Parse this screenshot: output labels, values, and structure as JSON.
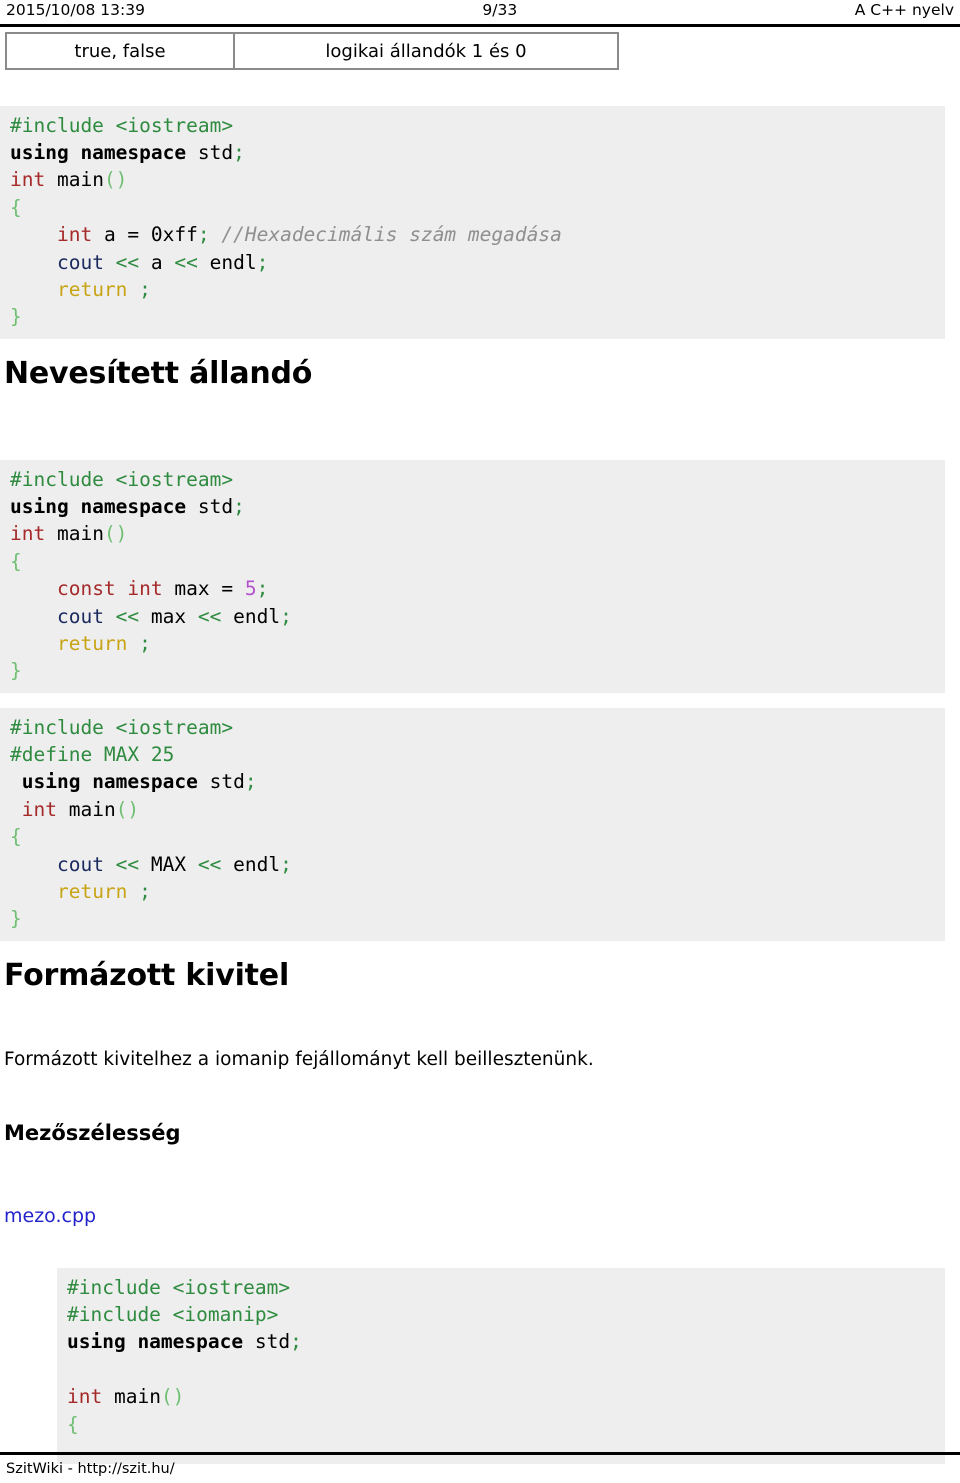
{
  "header": {
    "timestamp": "2015/10/08 13:39",
    "page_number": "9/33",
    "document_title": "A C++ nyelv"
  },
  "constants_table": {
    "rows": [
      {
        "name": "true, false",
        "description": "logikai állandók 1 és 0"
      }
    ]
  },
  "sections": [
    {
      "id": "nevesitett",
      "heading": "Nevesített állandó"
    },
    {
      "id": "formazott",
      "heading": "Formázott kivitel"
    }
  ],
  "subheadings": {
    "mezoszelesseg": "Mezőszélesség"
  },
  "paragraphs": {
    "iomanip_note": "Formázott kivitelhez a iomanip fejállományt kell beillesztenünk."
  },
  "links": {
    "mezo_cpp": "mezo.cpp"
  },
  "code_blocks": {
    "hex_example": {
      "lines": [
        [
          {
            "t": "#include <iostream>",
            "c": "s-pre"
          }
        ],
        [
          {
            "t": "using namespace",
            "c": "s-kw"
          },
          {
            "t": " std",
            "c": "s-id"
          },
          {
            "t": ";",
            "c": "s-op"
          }
        ],
        [
          {
            "t": "int",
            "c": "s-type"
          },
          {
            "t": " main",
            "c": "s-id"
          },
          {
            "t": "()",
            "c": "s-punc"
          }
        ],
        [
          {
            "t": "{",
            "c": "s-punc"
          }
        ],
        [
          {
            "t": "    ",
            "c": "s-id"
          },
          {
            "t": "int",
            "c": "s-type"
          },
          {
            "t": " a = ",
            "c": "s-id"
          },
          {
            "t": "0xff",
            "c": "s-id"
          },
          {
            "t": ";",
            "c": "s-op"
          },
          {
            "t": " ",
            "c": "s-id"
          },
          {
            "t": "//Hexadecimális szám megadása",
            "c": "s-com"
          }
        ],
        [
          {
            "t": "    ",
            "c": "s-id"
          },
          {
            "t": "cout",
            "c": "s-std"
          },
          {
            "t": " << ",
            "c": "s-op"
          },
          {
            "t": "a",
            "c": "s-id"
          },
          {
            "t": " << ",
            "c": "s-op"
          },
          {
            "t": "endl",
            "c": "s-id"
          },
          {
            "t": ";",
            "c": "s-op"
          }
        ],
        [
          {
            "t": "    ",
            "c": "s-id"
          },
          {
            "t": "return",
            "c": "s-ret"
          },
          {
            "t": " ",
            "c": "s-id"
          },
          {
            "t": ";",
            "c": "s-op"
          }
        ],
        [
          {
            "t": "}",
            "c": "s-punc"
          }
        ]
      ]
    },
    "const_example": {
      "lines": [
        [
          {
            "t": "#include <iostream>",
            "c": "s-pre"
          }
        ],
        [
          {
            "t": "using namespace",
            "c": "s-kw"
          },
          {
            "t": " std",
            "c": "s-id"
          },
          {
            "t": ";",
            "c": "s-op"
          }
        ],
        [
          {
            "t": "int",
            "c": "s-type"
          },
          {
            "t": " main",
            "c": "s-id"
          },
          {
            "t": "()",
            "c": "s-punc"
          }
        ],
        [
          {
            "t": "{",
            "c": "s-punc"
          }
        ],
        [
          {
            "t": "    ",
            "c": "s-id"
          },
          {
            "t": "const int",
            "c": "s-type"
          },
          {
            "t": " max = ",
            "c": "s-id"
          },
          {
            "t": "5",
            "c": "s-num"
          },
          {
            "t": ";",
            "c": "s-op"
          }
        ],
        [
          {
            "t": "    ",
            "c": "s-id"
          },
          {
            "t": "cout",
            "c": "s-std"
          },
          {
            "t": " << ",
            "c": "s-op"
          },
          {
            "t": "max",
            "c": "s-id"
          },
          {
            "t": " << ",
            "c": "s-op"
          },
          {
            "t": "endl",
            "c": "s-id"
          },
          {
            "t": ";",
            "c": "s-op"
          }
        ],
        [
          {
            "t": "    ",
            "c": "s-id"
          },
          {
            "t": "return",
            "c": "s-ret"
          },
          {
            "t": " ",
            "c": "s-id"
          },
          {
            "t": ";",
            "c": "s-op"
          }
        ],
        [
          {
            "t": "}",
            "c": "s-punc"
          }
        ]
      ]
    },
    "define_example": {
      "lines": [
        [
          {
            "t": "#include <iostream>",
            "c": "s-pre"
          }
        ],
        [
          {
            "t": "#define MAX 25",
            "c": "s-pre"
          }
        ],
        [
          {
            "t": " ",
            "c": "s-id"
          },
          {
            "t": "using namespace",
            "c": "s-kw"
          },
          {
            "t": " std",
            "c": "s-id"
          },
          {
            "t": ";",
            "c": "s-op"
          }
        ],
        [
          {
            "t": " ",
            "c": "s-id"
          },
          {
            "t": "int",
            "c": "s-type"
          },
          {
            "t": " main",
            "c": "s-id"
          },
          {
            "t": "()",
            "c": "s-punc"
          }
        ],
        [
          {
            "t": "{",
            "c": "s-punc"
          }
        ],
        [
          {
            "t": "    ",
            "c": "s-id"
          },
          {
            "t": "cout",
            "c": "s-std"
          },
          {
            "t": " << ",
            "c": "s-op"
          },
          {
            "t": "MAX",
            "c": "s-id"
          },
          {
            "t": " << ",
            "c": "s-op"
          },
          {
            "t": "endl",
            "c": "s-id"
          },
          {
            "t": ";",
            "c": "s-op"
          }
        ],
        [
          {
            "t": "    ",
            "c": "s-id"
          },
          {
            "t": "return",
            "c": "s-ret"
          },
          {
            "t": " ",
            "c": "s-id"
          },
          {
            "t": ";",
            "c": "s-op"
          }
        ],
        [
          {
            "t": "}",
            "c": "s-punc"
          }
        ]
      ]
    },
    "mezo_example": {
      "lines": [
        [
          {
            "t": "#include <iostream>",
            "c": "s-pre"
          }
        ],
        [
          {
            "t": "#include <iomanip>",
            "c": "s-pre"
          }
        ],
        [
          {
            "t": "using namespace",
            "c": "s-kw"
          },
          {
            "t": " std",
            "c": "s-id"
          },
          {
            "t": ";",
            "c": "s-op"
          }
        ],
        [
          {
            "t": "",
            "c": "s-id"
          }
        ],
        [
          {
            "t": "int",
            "c": "s-type"
          },
          {
            "t": " main",
            "c": "s-id"
          },
          {
            "t": "()",
            "c": "s-punc"
          }
        ],
        [
          {
            "t": "{",
            "c": "s-punc"
          }
        ]
      ]
    }
  },
  "footer": {
    "source": "SzitWiki - http://szit.hu/"
  },
  "colors": {
    "code_background": "#eeeeee",
    "preprocessor": "#2e8b3f",
    "type_keyword": "#a52a2a",
    "return_keyword": "#c8a415",
    "number_literal": "#b452cd",
    "stream_object": "#1b2a5e",
    "comment": "#8f8f8f",
    "punctuation": "#6fbf73",
    "link": "#2222cc",
    "table_border": "#8a8a8a"
  }
}
